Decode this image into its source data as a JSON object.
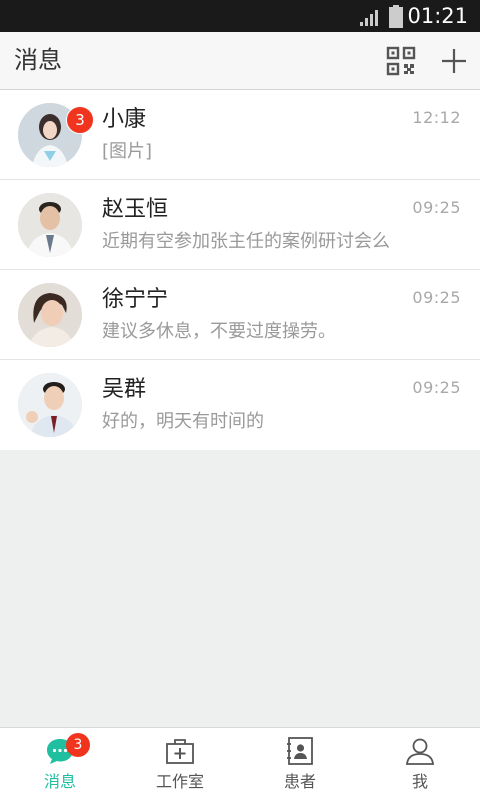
{
  "status_bar": {
    "time": "01:21",
    "icons": [
      "signal-icon",
      "battery-icon"
    ]
  },
  "header": {
    "title": "消息",
    "icons": [
      "qr-code-icon",
      "plus-icon"
    ]
  },
  "messages": [
    {
      "name": "小康",
      "preview": "[图片]",
      "time": "12:12",
      "unread": "3",
      "avatar": "avatar-female-nurse"
    },
    {
      "name": "赵玉恒",
      "preview": "近期有空参加张主任的案例研讨会么",
      "time": "09:25",
      "avatar": "avatar-male-doctor"
    },
    {
      "name": "徐宁宁",
      "preview": "建议多休息，不要过度操劳。",
      "time": "09:25",
      "avatar": "avatar-female"
    },
    {
      "name": "吴群",
      "preview": "好的，明天有时间的",
      "time": "09:25",
      "avatar": "avatar-male"
    }
  ],
  "tabbar": {
    "tabs": [
      {
        "label": "消息",
        "icon": "chat-bubble-icon",
        "active": true,
        "badge": "3"
      },
      {
        "label": "工作室",
        "icon": "medical-kit-icon",
        "active": false
      },
      {
        "label": "患者",
        "icon": "contacts-book-icon",
        "active": false
      },
      {
        "label": "我",
        "icon": "person-icon",
        "active": false
      }
    ]
  },
  "colors": {
    "accent": "#1fbf9f",
    "badge": "#f0341d",
    "status_bar": "#1a1a1a",
    "background": "#eef0ef"
  }
}
